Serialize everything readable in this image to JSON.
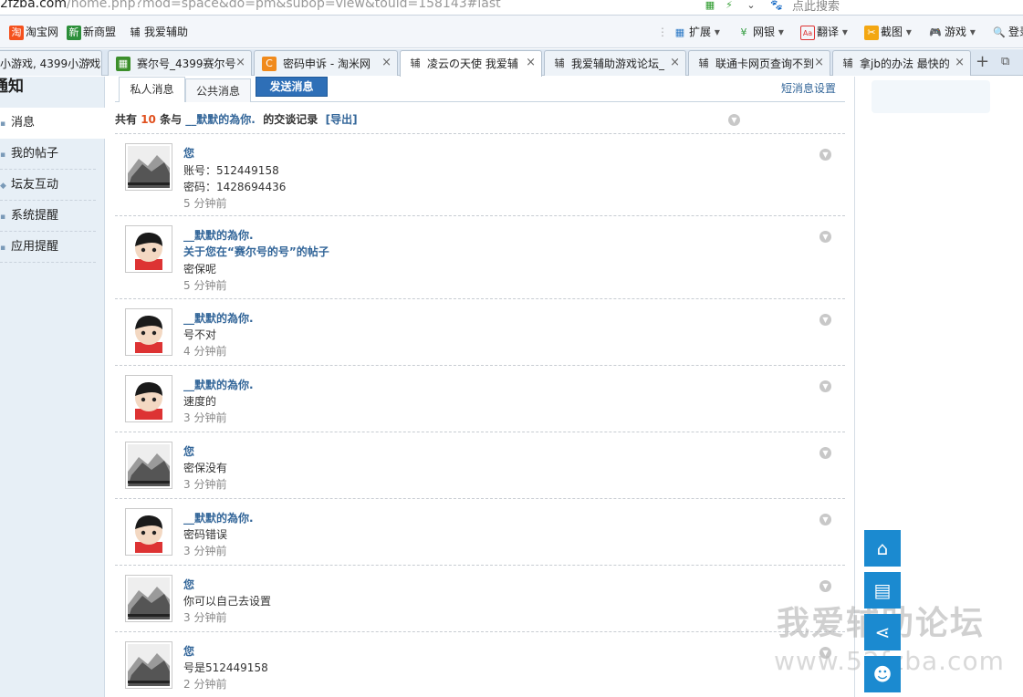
{
  "browser": {
    "url": {
      "domain": "2fzba.com",
      "path": "/home.php?mod=space&do=pm&subop=view&touid=158143#last"
    },
    "search_placeholder": "点此搜索",
    "bookmarks": [
      {
        "label": "淘宝网",
        "icon": "taobao-icon"
      },
      {
        "label": "新商盟",
        "icon": "xinshangmeng-icon"
      },
      {
        "label": "我爱辅助",
        "icon": "fu-icon"
      }
    ],
    "toolbar": [
      {
        "label": "扩展",
        "icon": "extensions-icon"
      },
      {
        "label": "网银",
        "icon": "bank-icon"
      },
      {
        "label": "翻译",
        "icon": "translate-icon"
      },
      {
        "label": "截图",
        "icon": "screenshot-icon"
      },
      {
        "label": "游戏",
        "icon": "gamepad-icon"
      },
      {
        "label": "登录",
        "icon": "login-icon"
      }
    ],
    "tabs": [
      {
        "title": "小游戏, 4399小游戏",
        "icon": "none"
      },
      {
        "title": "赛尔号_4399赛尔号",
        "icon": "seer-icon"
      },
      {
        "title": "密码申诉 - 淘米网",
        "icon": "taomi-icon"
      },
      {
        "title": "凌云の天使 我爱辅",
        "icon": "fu-icon",
        "active": true
      },
      {
        "title": "我爱辅助游戏论坛_",
        "icon": "fu-icon"
      },
      {
        "title": "联通卡网页查询不到",
        "icon": "fu-icon"
      },
      {
        "title": "拿jb的办法 最快的",
        "icon": "fu-icon"
      }
    ],
    "tab_icon_char": "辅",
    "close_char": "×",
    "new_tab_char": "+"
  },
  "sidebar": {
    "title": "通知",
    "current": "消息",
    "items": [
      "我的帖子",
      "坛友互动",
      "系统提醒",
      "应用提醒"
    ]
  },
  "pm": {
    "tabs": [
      "私人消息",
      "公共消息"
    ],
    "send_button": "发送消息",
    "settings_link": "短消息设置",
    "summary": {
      "prefix": "共有",
      "count": "10",
      "mid": "条与",
      "user": "__默默的為你.",
      "suffix": "的交谈记录",
      "export": "[导出]"
    },
    "messages": [
      {
        "author": "您",
        "lines": [
          "账号：512449158",
          "密码：1428694436"
        ],
        "time": "5 分钟前",
        "avatar": "landscape"
      },
      {
        "author": "__默默的為你.",
        "link": "关于您在“赛尔号的号”的帖子",
        "lines": [
          "密保呢"
        ],
        "time": "5 分钟前",
        "avatar": "boy"
      },
      {
        "author": "__默默的為你.",
        "lines": [
          "号不对"
        ],
        "time": "4 分钟前",
        "avatar": "boy"
      },
      {
        "author": "__默默的為你.",
        "lines": [
          "速度的"
        ],
        "time": "3 分钟前",
        "avatar": "boy"
      },
      {
        "author": "您",
        "lines": [
          "密保没有"
        ],
        "time": "3 分钟前",
        "avatar": "landscape"
      },
      {
        "author": "__默默的為你.",
        "lines": [
          "密码错误"
        ],
        "time": "3 分钟前",
        "avatar": "boy"
      },
      {
        "author": "您",
        "lines": [
          "你可以自己去设置"
        ],
        "time": "3 分钟前",
        "avatar": "landscape"
      },
      {
        "author": "您",
        "lines": [
          "号是512449158"
        ],
        "time": "2 分钟前",
        "avatar": "landscape"
      }
    ]
  },
  "float_buttons": [
    {
      "name": "back-to-top-button",
      "icon": "home-up-icon",
      "glyph": "⌂"
    },
    {
      "name": "post-button",
      "icon": "document-icon",
      "glyph": "▤"
    },
    {
      "name": "share-button",
      "icon": "share-icon",
      "glyph": "⋖"
    },
    {
      "name": "profile-button",
      "icon": "user-icon",
      "glyph": "☻"
    }
  ],
  "watermark": {
    "line1": "我爱辅助论坛",
    "line2": "www.52fzba.com"
  }
}
